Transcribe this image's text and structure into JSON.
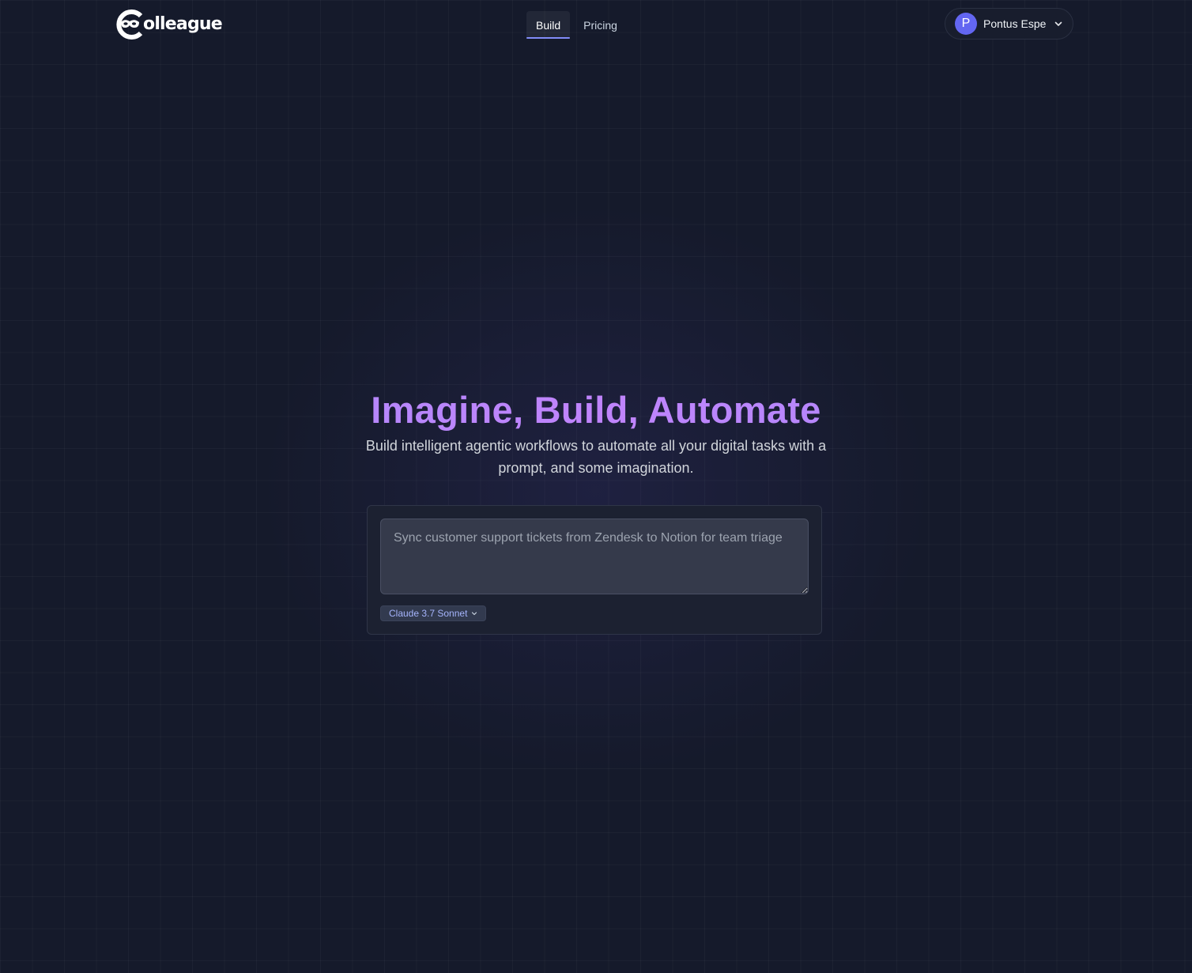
{
  "header": {
    "logo_text": "olleague",
    "nav": [
      {
        "label": "Build",
        "active": true
      },
      {
        "label": "Pricing",
        "active": false
      }
    ],
    "user": {
      "initial": "P",
      "name": "Pontus Espe"
    }
  },
  "hero": {
    "title": "Imagine, Build, Automate",
    "subtitle": "Build intelligent agentic workflows to automate all your digital tasks with a prompt, and some imagination."
  },
  "prompt": {
    "placeholder": "Sync customer support tickets from Zendesk to Notion for team triage",
    "value": "",
    "model": "Claude 3.7 Sonnet"
  },
  "colors": {
    "background": "#151a2b",
    "accent": "#818cf8",
    "avatar": "#6366f1",
    "title_gradient_start": "#a78bfa",
    "title_gradient_mid": "#c084fc"
  },
  "icons": {
    "logo": "colleague-mask-logo-icon",
    "user_menu": "chevron-down-icon",
    "model_select": "chevron-down-icon"
  }
}
